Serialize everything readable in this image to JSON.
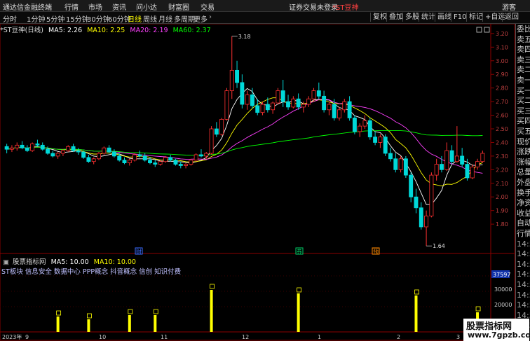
{
  "menu": {
    "app_name": "通达信金融终端",
    "items": [
      "行情",
      "市场",
      "资讯",
      "问小达",
      "财富圈",
      "交易"
    ],
    "alert": "证券交易未登录",
    "stock_tag": "*ST豆神",
    "user": "游客"
  },
  "toolbar": {
    "periods": [
      "分时",
      "1分钟",
      "5分钟",
      "15分钟",
      "30分钟",
      "60分钟",
      "日线",
      "周线",
      "月线",
      "多周期",
      "更多"
    ],
    "active": "日线",
    "right_buttons": [
      "复权",
      "叠加",
      "多股",
      "统计",
      "画线",
      "F10",
      "标记",
      "+自选",
      "返回"
    ]
  },
  "legend": {
    "title": "*ST豆神(日线)",
    "ma5": "MA5: 2.26",
    "ma10": "MA10: 2.25",
    "ma20": "MA20: 2.19",
    "ma60": "MA60: 2.37",
    "colors": {
      "ma5": "#ffffff",
      "ma10": "#ffff00",
      "ma20": "#ff40ff",
      "ma60": "#00ff00"
    }
  },
  "price_axis": {
    "ticks": [
      "3.20",
      "3.10",
      "3.00",
      "2.90",
      "2.80",
      "2.70",
      "2.60",
      "2.50",
      "2.40",
      "2.30",
      "2.20",
      "2.10",
      "2.00",
      "1.90",
      "1.80"
    ],
    "high_label": "3.18",
    "low_label": "1.64"
  },
  "event_markers": [
    "财",
    "券",
    "预"
  ],
  "volume": {
    "title": "股票指标网",
    "ma5": "MA5: 10.00",
    "ma10": "MA10: 10.00",
    "tags": "ST板块 信息安全 数据中心 PPP概念 抖音概念 信创 知识付费",
    "axis_ticks": [
      "37597",
      "30000",
      "20000"
    ],
    "bar_marker": "点"
  },
  "date_axis": {
    "labels": [
      "2023年",
      "9",
      "10",
      "11",
      "12",
      "1",
      "2",
      "3"
    ]
  },
  "right_panel": {
    "items": [
      "委比",
      "卖五",
      "卖四",
      "卖三",
      "卖二",
      "卖一",
      "买一",
      "买二",
      "买三",
      "买四",
      "买五",
      "现价",
      "涨跌",
      "涨幅",
      "总量",
      "外盘",
      "换手",
      "净资",
      "收益",
      "自动",
      "行情",
      "14:5",
      "14:5",
      "14:5",
      "14:5",
      "14:5",
      "14:5",
      "14:5",
      "14:5",
      "14:5",
      "14:5"
    ]
  },
  "watermark": {
    "line1": "股票指标网",
    "line2": "www.7gpzb.com"
  },
  "chart_data": {
    "type": "candlestick",
    "title": "*ST豆神(日线)",
    "ylim": [
      1.6,
      3.22
    ],
    "ohlc": [
      [
        2.37,
        2.39,
        2.32,
        2.35
      ],
      [
        2.35,
        2.38,
        2.33,
        2.36
      ],
      [
        2.36,
        2.4,
        2.34,
        2.38
      ],
      [
        2.38,
        2.41,
        2.35,
        2.36
      ],
      [
        2.36,
        2.38,
        2.33,
        2.34
      ],
      [
        2.34,
        2.4,
        2.33,
        2.39
      ],
      [
        2.39,
        2.42,
        2.37,
        2.38
      ],
      [
        2.38,
        2.4,
        2.34,
        2.35
      ],
      [
        2.35,
        2.37,
        2.31,
        2.32
      ],
      [
        2.32,
        2.34,
        2.29,
        2.3
      ],
      [
        2.3,
        2.33,
        2.28,
        2.32
      ],
      [
        2.32,
        2.35,
        2.3,
        2.34
      ],
      [
        2.34,
        2.38,
        2.33,
        2.37
      ],
      [
        2.37,
        2.39,
        2.33,
        2.34
      ],
      [
        2.34,
        2.36,
        2.31,
        2.33
      ],
      [
        2.33,
        2.34,
        2.28,
        2.29
      ],
      [
        2.29,
        2.31,
        2.25,
        2.26
      ],
      [
        2.26,
        2.29,
        2.24,
        2.28
      ],
      [
        2.28,
        2.33,
        2.27,
        2.32
      ],
      [
        2.32,
        2.37,
        2.31,
        2.36
      ],
      [
        2.36,
        2.38,
        2.32,
        2.33
      ],
      [
        2.33,
        2.35,
        2.29,
        2.3
      ],
      [
        2.3,
        2.32,
        2.26,
        2.27
      ],
      [
        2.27,
        2.29,
        2.24,
        2.25
      ],
      [
        2.25,
        2.28,
        2.23,
        2.27
      ],
      [
        2.27,
        2.32,
        2.26,
        2.31
      ],
      [
        2.31,
        2.34,
        2.29,
        2.3
      ],
      [
        2.3,
        2.32,
        2.26,
        2.27
      ],
      [
        2.27,
        2.29,
        2.24,
        2.25
      ],
      [
        2.25,
        2.27,
        2.22,
        2.24
      ],
      [
        2.24,
        2.27,
        2.23,
        2.26
      ],
      [
        2.26,
        2.3,
        2.25,
        2.29
      ],
      [
        2.29,
        2.31,
        2.26,
        2.27
      ],
      [
        2.27,
        2.28,
        2.23,
        2.24
      ],
      [
        2.24,
        2.26,
        2.21,
        2.23
      ],
      [
        2.23,
        2.25,
        2.21,
        2.24
      ],
      [
        2.24,
        2.28,
        2.23,
        2.27
      ],
      [
        2.27,
        2.32,
        2.26,
        2.31
      ],
      [
        2.31,
        2.35,
        2.29,
        2.3
      ],
      [
        2.3,
        2.33,
        2.28,
        2.32
      ],
      [
        2.32,
        2.52,
        2.31,
        2.5
      ],
      [
        2.5,
        2.55,
        2.44,
        2.46
      ],
      [
        2.46,
        2.58,
        2.45,
        2.57
      ],
      [
        2.57,
        2.8,
        2.56,
        2.78
      ],
      [
        2.78,
        3.18,
        2.72,
        2.93
      ],
      [
        2.93,
        3.0,
        2.8,
        2.84
      ],
      [
        2.84,
        2.9,
        2.65,
        2.68
      ],
      [
        2.68,
        2.78,
        2.64,
        2.75
      ],
      [
        2.75,
        2.8,
        2.65,
        2.67
      ],
      [
        2.67,
        2.72,
        2.6,
        2.62
      ],
      [
        2.62,
        2.7,
        2.6,
        2.68
      ],
      [
        2.68,
        2.73,
        2.62,
        2.64
      ],
      [
        2.64,
        2.7,
        2.61,
        2.69
      ],
      [
        2.69,
        2.8,
        2.68,
        2.78
      ],
      [
        2.78,
        2.86,
        2.66,
        2.7
      ],
      [
        2.7,
        2.75,
        2.64,
        2.66
      ],
      [
        2.66,
        2.74,
        2.65,
        2.72
      ],
      [
        2.72,
        2.76,
        2.64,
        2.66
      ],
      [
        2.66,
        2.7,
        2.62,
        2.68
      ],
      [
        2.68,
        2.74,
        2.66,
        2.72
      ],
      [
        2.72,
        2.8,
        2.7,
        2.78
      ],
      [
        2.78,
        2.84,
        2.72,
        2.74
      ],
      [
        2.74,
        2.78,
        2.62,
        2.64
      ],
      [
        2.64,
        2.7,
        2.6,
        2.68
      ],
      [
        2.68,
        2.72,
        2.56,
        2.58
      ],
      [
        2.58,
        2.66,
        2.56,
        2.64
      ],
      [
        2.64,
        2.72,
        2.62,
        2.7
      ],
      [
        2.7,
        2.74,
        2.56,
        2.58
      ],
      [
        2.58,
        2.6,
        2.46,
        2.48
      ],
      [
        2.48,
        2.54,
        2.44,
        2.52
      ],
      [
        2.52,
        2.6,
        2.5,
        2.56
      ],
      [
        2.56,
        2.58,
        2.42,
        2.44
      ],
      [
        2.44,
        2.48,
        2.38,
        2.4
      ],
      [
        2.4,
        2.46,
        2.36,
        2.44
      ],
      [
        2.44,
        2.46,
        2.3,
        2.32
      ],
      [
        2.32,
        2.36,
        2.26,
        2.28
      ],
      [
        2.28,
        2.32,
        2.18,
        2.2
      ],
      [
        2.2,
        2.3,
        2.18,
        2.28
      ],
      [
        2.28,
        2.3,
        2.14,
        2.16
      ],
      [
        2.16,
        2.18,
        1.96,
        2.0
      ],
      [
        2.0,
        2.06,
        1.88,
        1.92
      ],
      [
        1.92,
        1.96,
        1.76,
        1.78
      ],
      [
        1.78,
        1.9,
        1.64,
        1.86
      ],
      [
        1.86,
        2.18,
        1.85,
        2.16
      ],
      [
        2.16,
        2.28,
        2.12,
        2.24
      ],
      [
        2.24,
        2.3,
        2.18,
        2.2
      ],
      [
        2.2,
        2.4,
        2.19,
        2.34
      ],
      [
        2.34,
        2.38,
        2.24,
        2.26
      ],
      [
        2.26,
        2.52,
        2.25,
        2.3
      ],
      [
        2.3,
        2.36,
        2.22,
        2.24
      ],
      [
        2.24,
        2.28,
        2.12,
        2.14
      ],
      [
        2.14,
        2.24,
        2.13,
        2.22
      ],
      [
        2.22,
        2.28,
        2.2,
        2.26
      ],
      [
        2.26,
        2.34,
        2.25,
        2.32
      ]
    ],
    "ma_series": [
      "MA5",
      "MA10",
      "MA20",
      "MA60"
    ],
    "volume_markers_x_index": [
      10,
      16,
      24,
      29,
      40,
      57,
      80,
      92,
      103,
      110,
      112
    ]
  }
}
